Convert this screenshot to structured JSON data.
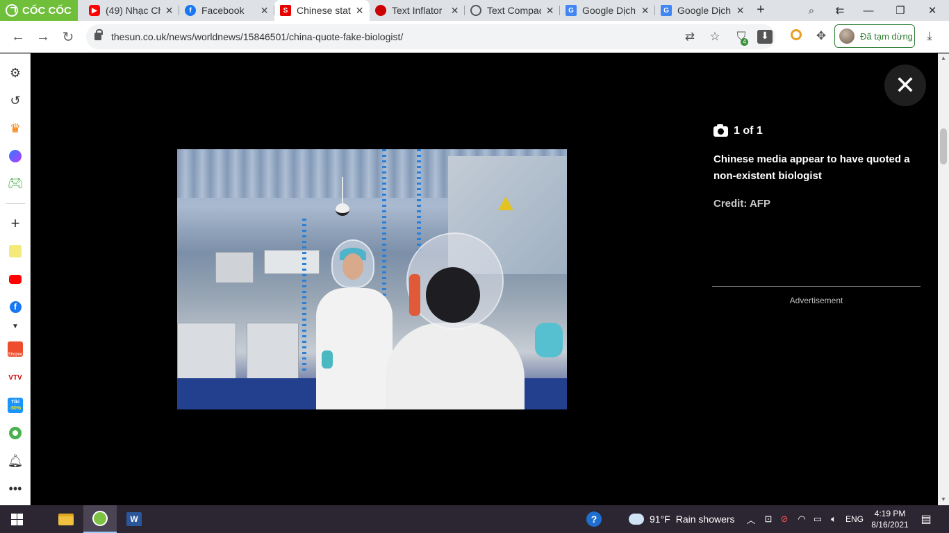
{
  "browser": {
    "logo_text": "CỐC CỐC",
    "tabs": [
      {
        "label": "(49) Nhạc Ch",
        "favicon": "youtube-icon",
        "active": false
      },
      {
        "label": "Facebook",
        "favicon": "facebook-icon",
        "active": false
      },
      {
        "label": "Chinese stat",
        "favicon": "thesun-icon",
        "active": true
      },
      {
        "label": "Text Inflator",
        "favicon": "text-inflator-icon",
        "active": false
      },
      {
        "label": "Text Compac",
        "favicon": "globe-icon",
        "active": false
      },
      {
        "label": "Google Dịch",
        "favicon": "google-translate-icon",
        "active": false
      },
      {
        "label": "Google Dịch",
        "favicon": "google-translate-icon",
        "active": false
      }
    ],
    "new_tab_label": "+",
    "url": "thesun.co.uk/news/worldnews/15846501/china-quote-fake-biologist/",
    "extension_badge": "4",
    "profile_label": "Đã tạm dừng"
  },
  "sidebar": {
    "items": [
      "settings-icon",
      "history-icon",
      "crown-icon",
      "messenger-icon",
      "game-controller-icon",
      "add-icon",
      "notes-icon",
      "youtube-icon",
      "facebook-icon",
      "shopee-icon",
      "vtv-go-icon",
      "tiki-icon",
      "soccer-icon",
      "bell-icon",
      "more-icon"
    ],
    "vtv_label": "VTV",
    "tiki_label": "Tiki",
    "tiki_discount": "-50%",
    "shopee_label": "Shopee"
  },
  "gallery": {
    "counter": "1 of 1",
    "caption": "Chinese media appear to have quoted a non-existent biologist",
    "credit": "Credit: AFP",
    "advertisement_label": "Advertisement",
    "close_label": "✕"
  },
  "taskbar": {
    "weather_temp": "91°F",
    "weather_desc": "Rain showers",
    "language": "ENG",
    "time": "4:19 PM",
    "date": "8/16/2021",
    "word_label": "W"
  },
  "colors": {
    "coccoc_green": "#6fbf3a",
    "profile_green": "#2e7d32",
    "viewer_bg": "#000000",
    "taskbar_bg": "#2b2632"
  }
}
